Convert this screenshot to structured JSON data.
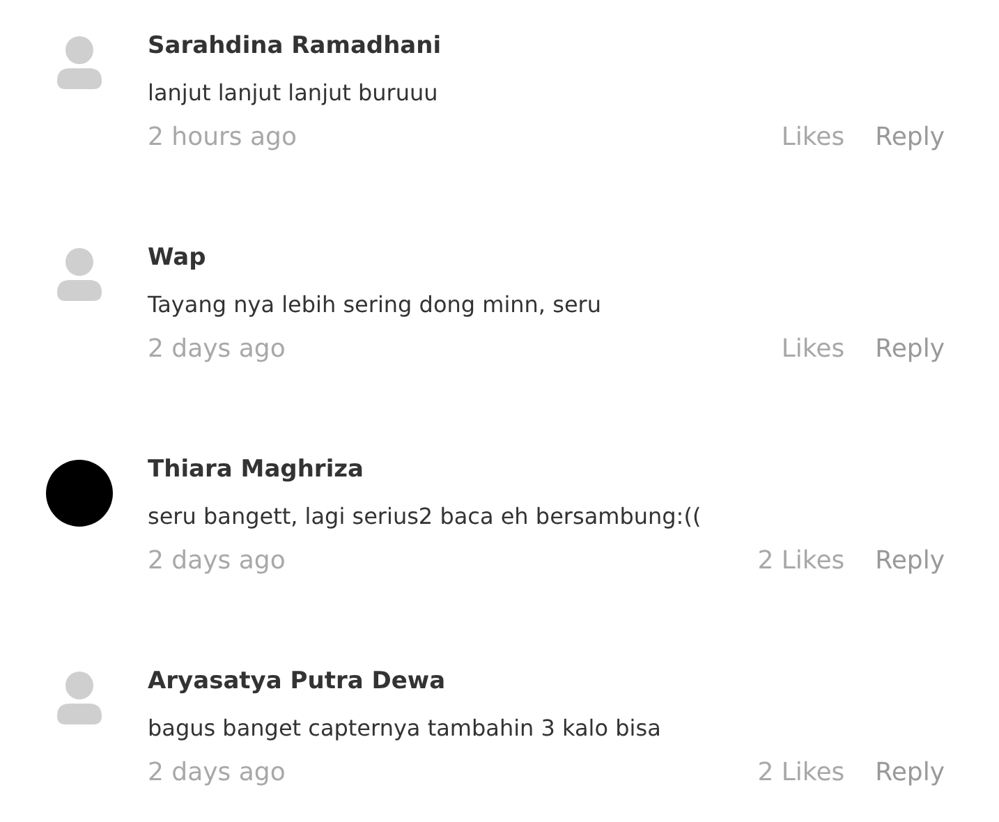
{
  "comments": [
    {
      "kind": "default",
      "name": "Sarahdina Ramadhani",
      "text": "lanjut lanjut lanjut buruuu",
      "time": "2 hours ago",
      "likes": "Likes",
      "reply": "Reply"
    },
    {
      "kind": "default",
      "name": "Wap",
      "text": "Tayang nya lebih sering dong minn, seru",
      "time": "2 days ago",
      "likes": "Likes",
      "reply": "Reply"
    },
    {
      "kind": "photo",
      "name": "Thiara Maghriza",
      "text": "seru bangett, lagi serius2 baca eh bersambung:((",
      "time": "2 days ago",
      "likes": "2 Likes",
      "reply": "Reply"
    },
    {
      "kind": "default",
      "name": "Aryasatya Putra Dewa",
      "text": "bagus banget capternya tambahin 3 kalo bisa",
      "time": "2 days ago",
      "likes": "2 Likes",
      "reply": "Reply"
    }
  ]
}
